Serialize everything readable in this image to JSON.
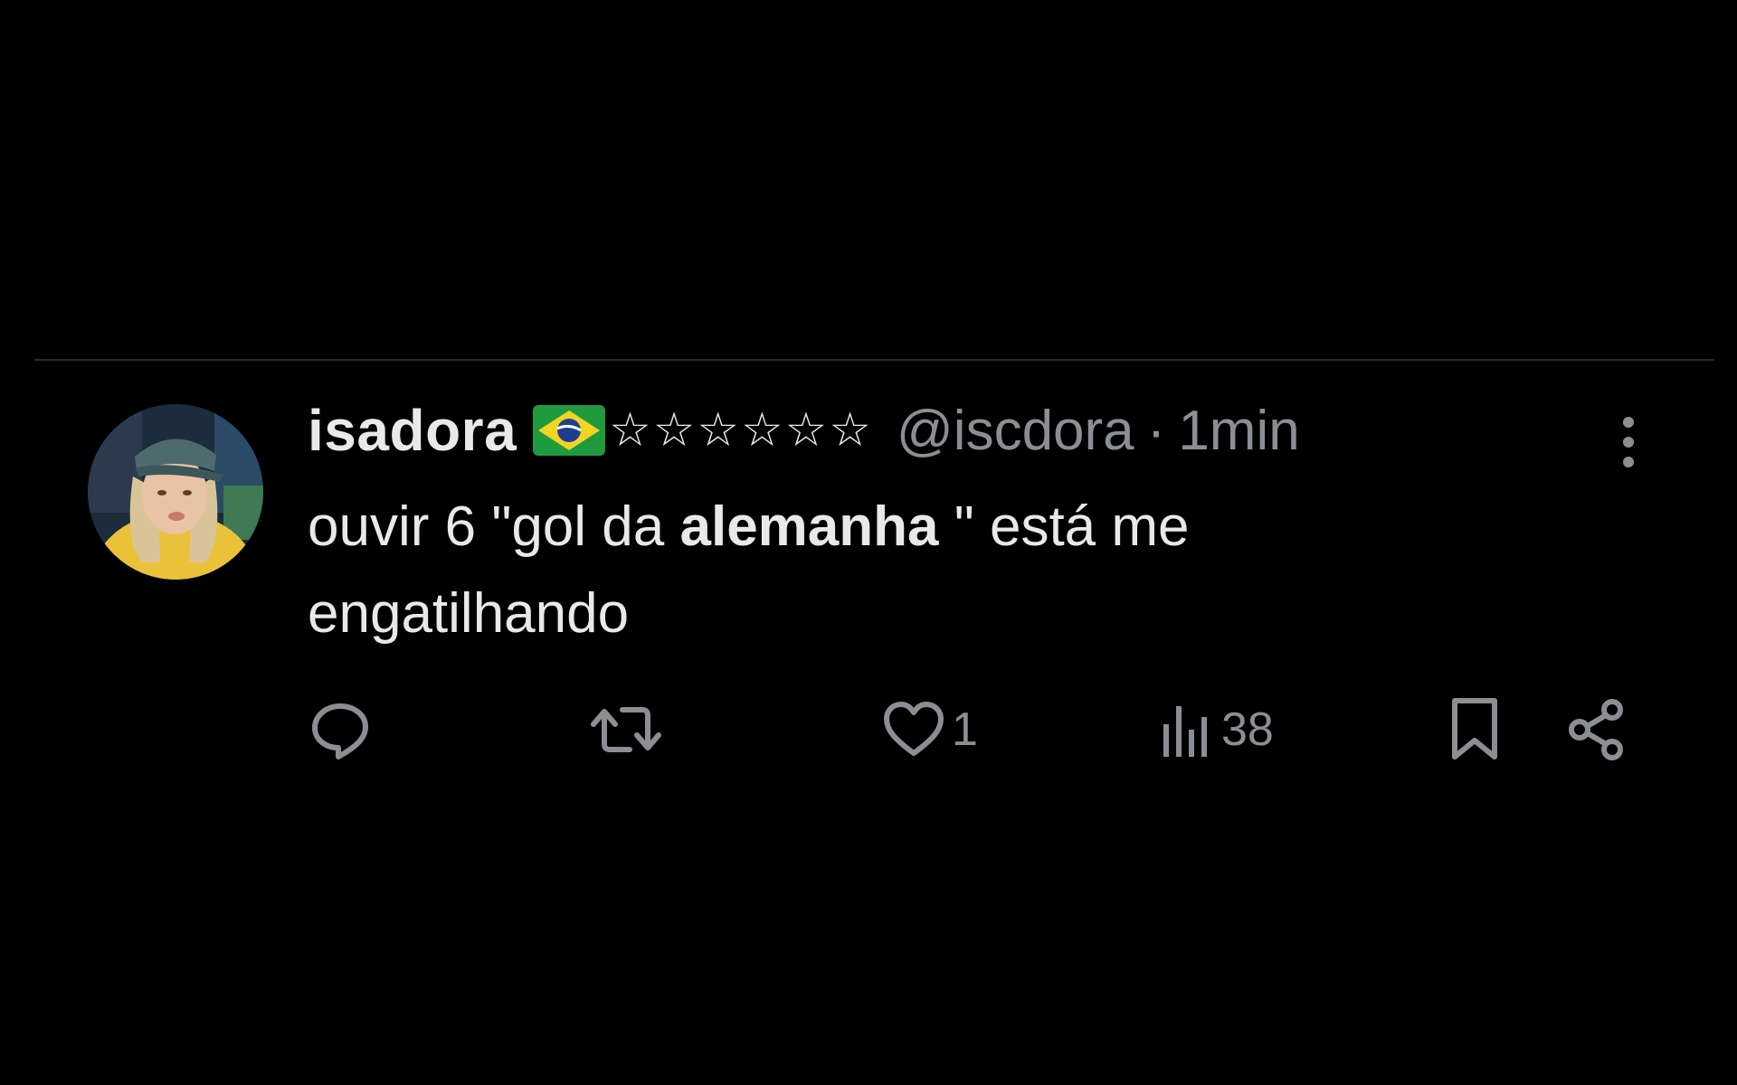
{
  "tweet": {
    "display_name": "isadora",
    "name_emoji": "brazil-flag",
    "stars": "☆☆☆☆☆☆",
    "handle": "@iscdora",
    "separator": "·",
    "time": "1min",
    "text_before": "ouvir 6 \"gol da ",
    "text_bold": "alemanha",
    "text_after": " \" está me engatilhando"
  },
  "actions": {
    "reply": {
      "icon": "reply-icon"
    },
    "retweet": {
      "icon": "retweet-icon"
    },
    "like": {
      "icon": "heart-icon",
      "count": "1"
    },
    "views": {
      "icon": "bar-chart-icon",
      "count": "38"
    },
    "bookmark": {
      "icon": "bookmark-icon"
    },
    "share": {
      "icon": "share-icon"
    }
  },
  "colors": {
    "background": "#000000",
    "text": "#e7e9ea",
    "secondary": "#8b8f94",
    "divider": "#2a2c2f"
  }
}
